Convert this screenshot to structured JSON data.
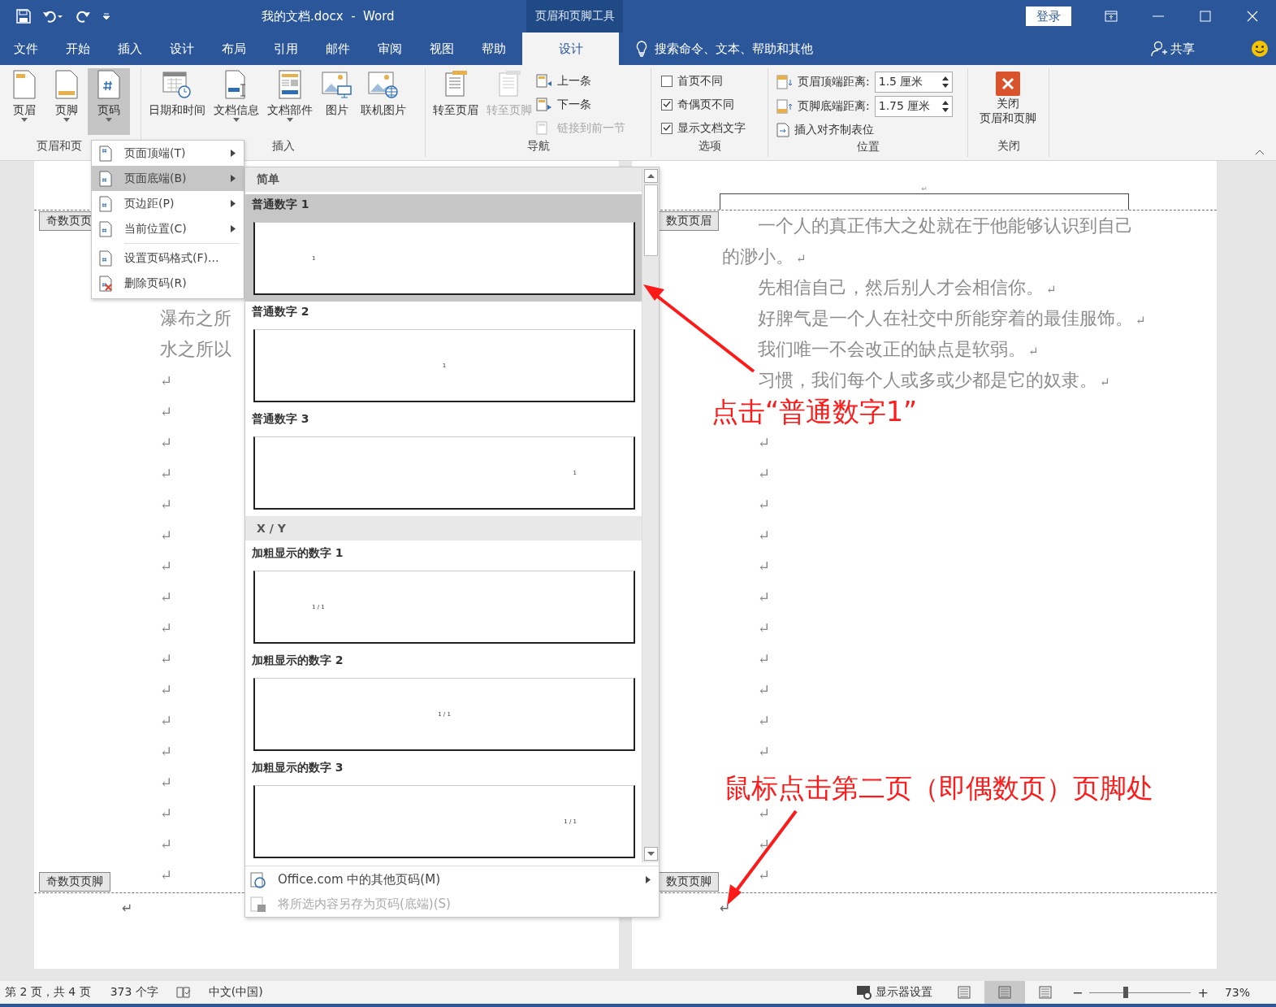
{
  "title_bar": {
    "title": "我的文档.docx  -  Word",
    "context_label": "页眉和页脚工具",
    "login": "登录"
  },
  "tabs": [
    {
      "label": "文件",
      "selected": false,
      "kind": "normal"
    },
    {
      "label": "开始",
      "selected": false,
      "kind": "normal"
    },
    {
      "label": "插入",
      "selected": false,
      "kind": "normal"
    },
    {
      "label": "设计",
      "selected": false,
      "kind": "normal"
    },
    {
      "label": "布局",
      "selected": false,
      "kind": "normal"
    },
    {
      "label": "引用",
      "selected": false,
      "kind": "normal"
    },
    {
      "label": "邮件",
      "selected": false,
      "kind": "normal"
    },
    {
      "label": "审阅",
      "selected": false,
      "kind": "normal"
    },
    {
      "label": "视图",
      "selected": false,
      "kind": "normal"
    },
    {
      "label": "帮助",
      "selected": false,
      "kind": "normal"
    },
    {
      "label": "设计",
      "selected": true,
      "kind": "context"
    }
  ],
  "search": {
    "placeholder": "搜索命令、文本、帮助和其他"
  },
  "share": "共享",
  "ribbon": {
    "header_footer": {
      "label": "页眉和页",
      "buttons": [
        {
          "label": "页眉",
          "has_menu": true,
          "selected": false
        },
        {
          "label": "页脚",
          "has_menu": true,
          "selected": false
        },
        {
          "label": "页码",
          "has_menu": true,
          "selected": true
        }
      ]
    },
    "insert": {
      "label": "插入",
      "buttons": [
        {
          "label": "日期和时间",
          "has_menu": false
        },
        {
          "label": "文档信息",
          "has_menu": true
        },
        {
          "label": "文档部件",
          "has_menu": true
        },
        {
          "label": "图片",
          "has_menu": false
        },
        {
          "label": "联机图片",
          "has_menu": false
        }
      ]
    },
    "navigation": {
      "label": "导航",
      "big": [
        {
          "label": "转至页眉",
          "disabled": false
        },
        {
          "label": "转至页脚",
          "disabled": true
        }
      ],
      "small": [
        {
          "label": "上一条",
          "disabled": false
        },
        {
          "label": "下一条",
          "disabled": false
        },
        {
          "label": "链接到前一节",
          "disabled": true
        }
      ]
    },
    "options": {
      "label": "选项",
      "checks": [
        {
          "label": "首页不同",
          "checked": false
        },
        {
          "label": "奇偶页不同",
          "checked": true
        },
        {
          "label": "显示文档文字",
          "checked": true
        }
      ]
    },
    "position": {
      "label": "位置",
      "fields": [
        {
          "label": "页眉顶端距离:",
          "value": "1.5 厘米"
        },
        {
          "label": "页脚底端距离:",
          "value": "1.75 厘米"
        }
      ],
      "insert_tab": "插入对齐制表位"
    },
    "close": {
      "label": "关闭",
      "lines": [
        "关闭",
        "页眉和页脚"
      ]
    }
  },
  "menu": {
    "items": [
      {
        "label": "页面顶端(T)",
        "has_submenu": true,
        "selected": false
      },
      {
        "label": "页面底端(B)",
        "has_submenu": true,
        "selected": true
      },
      {
        "label": "页边距(P)",
        "has_submenu": true,
        "selected": false
      },
      {
        "label": "当前位置(C)",
        "has_submenu": true,
        "selected": false
      },
      {
        "label": "设置页码格式(F)...",
        "has_submenu": false,
        "selected": false
      },
      {
        "label": "删除页码(R)",
        "has_submenu": false,
        "selected": false
      }
    ]
  },
  "gallery": {
    "sections": [
      {
        "title": "简单",
        "items": [
          {
            "title": "普通数字 1",
            "preview": "1",
            "selected": true
          },
          {
            "title": "普通数字 2",
            "preview": "1",
            "selected": false
          },
          {
            "title": "普通数字 3",
            "preview": "1",
            "selected": false
          }
        ]
      },
      {
        "title": "X / Y",
        "items": [
          {
            "title": "加粗显示的数字 1",
            "preview": "1 / 1",
            "selected": false
          },
          {
            "title": "加粗显示的数字 2",
            "preview": "1 / 1",
            "selected": false
          },
          {
            "title": "加粗显示的数字 3",
            "preview": "1 / 1",
            "selected": false
          }
        ]
      }
    ],
    "footer_items": [
      {
        "label": "Office.com 中的其他页码(M)",
        "disabled": false,
        "has_submenu": true
      },
      {
        "label": "将所选内容另存为页码(底端)(S)",
        "disabled": true,
        "has_submenu": false
      }
    ]
  },
  "pages": [
    {
      "header_tag": "奇数页页",
      "paragraphs": [
        {
          "text": "瀑布之所"
        },
        {
          "text": "水之所以"
        }
      ],
      "marks": [
        "↵",
        "↵",
        "↵",
        "↵",
        "↵",
        "↵",
        "↵",
        "↵",
        "↵",
        "↵",
        "↵",
        "↵",
        "↵",
        "↵",
        "↵",
        "↵",
        "↵"
      ],
      "footer_tag": "奇数页页脚",
      "footer_mark": "↵"
    },
    {
      "header_mark": "↵",
      "header_tag": "数页页眉",
      "paragraphs": [
        {
          "text": "一个人的真正伟大之处就在于他能够认识到自己的渺小。",
          "mark": "↵"
        },
        {
          "text": "先相信自己，然后别人才会相信你。",
          "mark": "↵"
        },
        {
          "text": "好脾气是一个人在社交中所能穿着的最佳服饰。",
          "mark": "↵"
        },
        {
          "text": "我们唯一不会改正的缺点是软弱。",
          "mark": "↵"
        },
        {
          "text": "习惯，我们每个人或多或少都是它的奴隶。",
          "mark": "↵"
        }
      ],
      "marks": [
        "↵",
        "↵",
        "↵",
        "↵",
        "↵",
        "↵",
        "↵",
        "↵",
        "↵",
        "↵",
        "↵",
        "↵",
        "↵",
        "↵"
      ],
      "footer_tag": "数页页脚",
      "footer_mark": "↵"
    }
  ],
  "annotations": [
    {
      "text": "点击“普通数字1”"
    },
    {
      "text": "鼠标点击第二页（即偶数页）页脚处"
    }
  ],
  "status_bar": {
    "page": "第 2 页，共 4 页",
    "words": "373 个字",
    "language": "中文(中国)",
    "display_settings": "显示器设置",
    "views": [
      {
        "selected": false
      },
      {
        "selected": true
      },
      {
        "selected": false
      }
    ],
    "zoom_out": "−",
    "zoom_in": "+",
    "zoom": {
      "level": 0.36
    },
    "zoom_text": "73%"
  }
}
